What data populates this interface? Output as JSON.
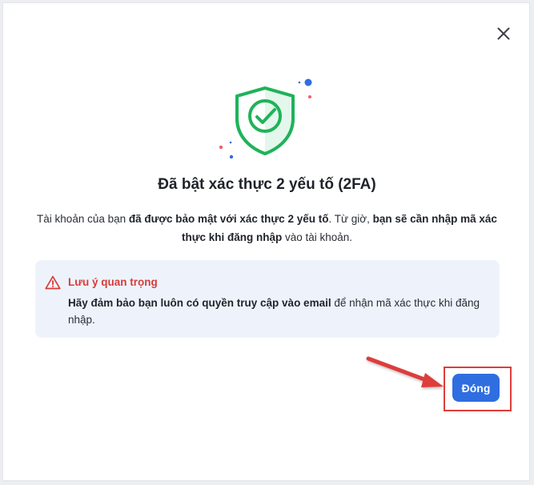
{
  "dialog": {
    "title": "Đã bật xác thực 2 yếu tố (2FA)",
    "description": {
      "part1": "Tài khoản của bạn ",
      "bold1": "đã được bảo mật với xác thực 2 yếu tố",
      "part2": ". Từ giờ, ",
      "bold2": "bạn sẽ cần nhập mã xác thực khi đăng nhập",
      "part3": " vào tài khoản."
    },
    "notice": {
      "icon": "warning-triangle-icon",
      "title": "Lưu ý quan trọng",
      "bold": "Hãy đảm bảo bạn luôn có quyền truy cập vào email",
      "text": " để nhận mã xác thực khi đăng nhập."
    },
    "close_button_label": "Đóng",
    "close_icon": "close-icon",
    "hero_icon": "shield-check-icon"
  },
  "colors": {
    "primary": "#2f6ee0",
    "success": "#1fb35a",
    "warning": "#d83a3a",
    "annotation": "#dd3d3a"
  }
}
